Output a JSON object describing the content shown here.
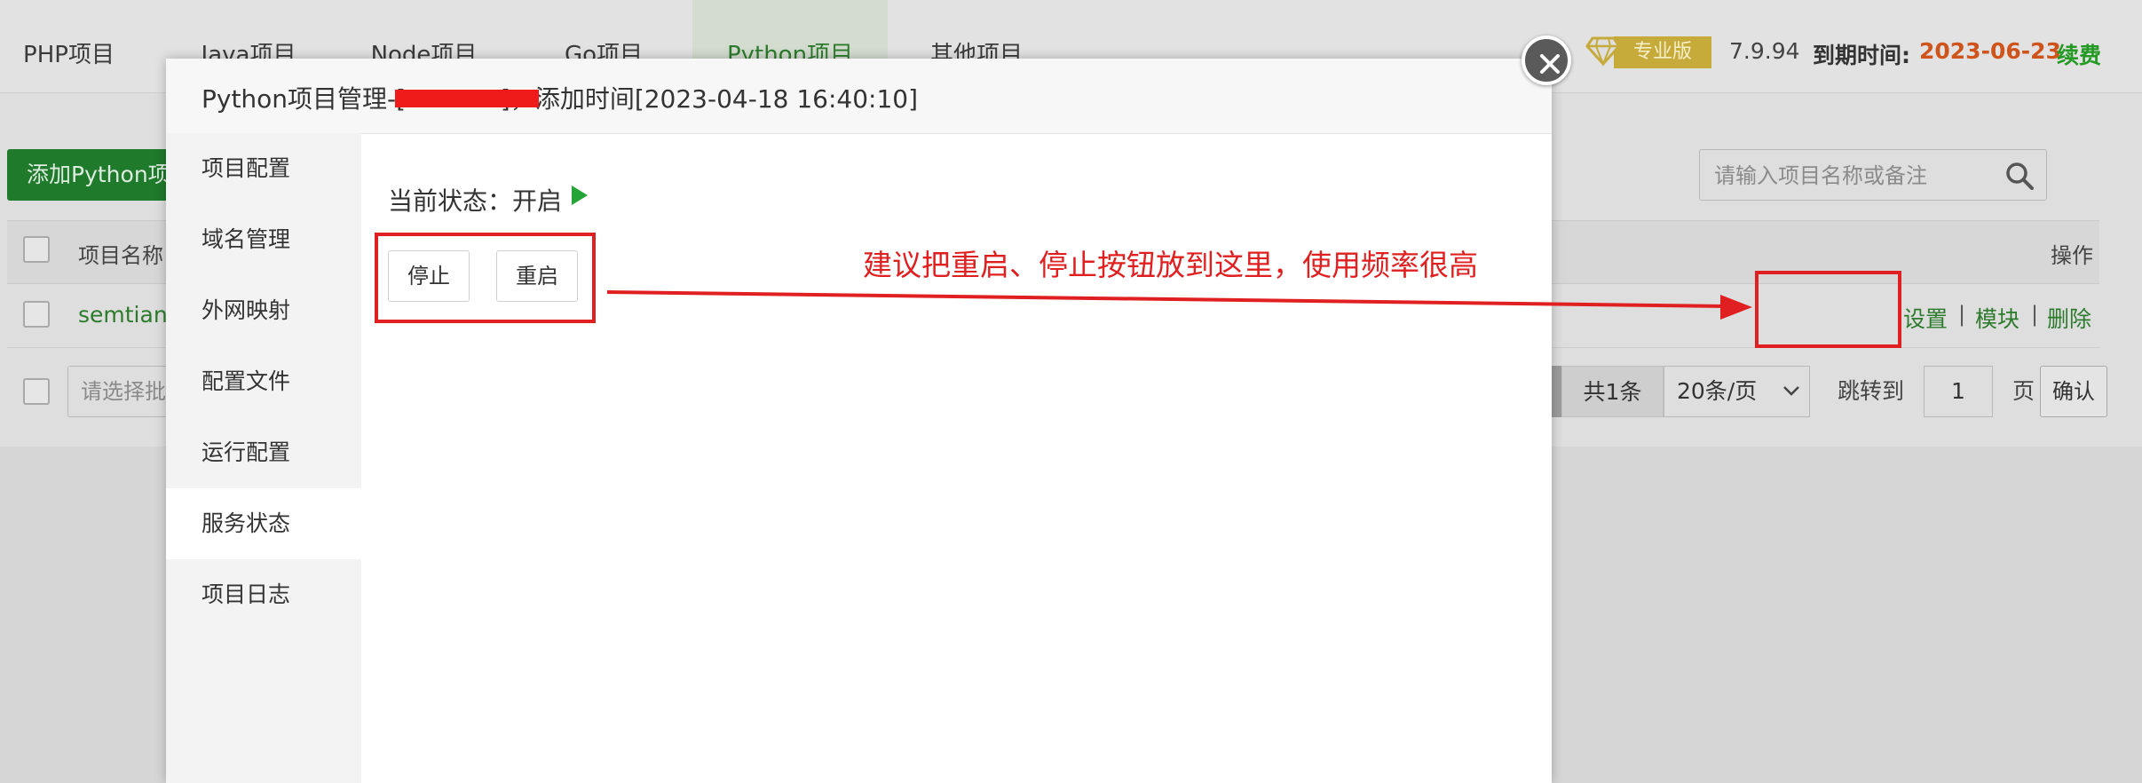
{
  "top_tabs": [
    {
      "label": "PHP项目",
      "active": false
    },
    {
      "label": "Java项目",
      "active": false
    },
    {
      "label": "Node项目",
      "active": false
    },
    {
      "label": "Go项目",
      "active": false
    },
    {
      "label": "Python项目",
      "active": true
    },
    {
      "label": "其他项目",
      "active": false
    }
  ],
  "header": {
    "edition": "专业版",
    "version": "7.9.94",
    "expire_label": "到期时间:",
    "expire_date": "2023-06-23",
    "renew": "续费",
    "colors": {
      "expire_date": "#cf541c",
      "renew": "#249a24",
      "badge": "#c6ab3b"
    }
  },
  "toolbar": {
    "add_button": "添加Python项",
    "search_placeholder": "请输入项目名称或备注",
    "search_icon": "search-icon"
  },
  "table": {
    "columns": [
      "项目名称",
      "操作"
    ],
    "rows": [
      {
        "name": "semtiany",
        "actions": [
          "设置",
          "模块",
          "删除"
        ],
        "separator": "|"
      }
    ]
  },
  "footer": {
    "batch_placeholder": "请选择批",
    "total": "共1条",
    "page_size": "20条/页",
    "jump_label": "跳转到",
    "page_input": "1",
    "page_unit": "页",
    "confirm": "确认"
  },
  "modal": {
    "title": "Python项目管理-[            ]，添加时间[2023-04-18 16:40:10]",
    "nav": [
      {
        "label": "项目配置",
        "active": false
      },
      {
        "label": "域名管理",
        "active": false
      },
      {
        "label": "外网映射",
        "active": false
      },
      {
        "label": "配置文件",
        "active": false
      },
      {
        "label": "运行配置",
        "active": false
      },
      {
        "label": "服务状态",
        "active": true
      },
      {
        "label": "项目日志",
        "active": false
      }
    ],
    "status_label": "当前状态：开启",
    "stop_button": "停止",
    "restart_button": "重启",
    "close_icon": "close-icon",
    "play_icon": "play-icon"
  },
  "annotation": {
    "text": "建议把重启、停止按钮放到这里，使用频率很高",
    "color": "#e02020"
  }
}
